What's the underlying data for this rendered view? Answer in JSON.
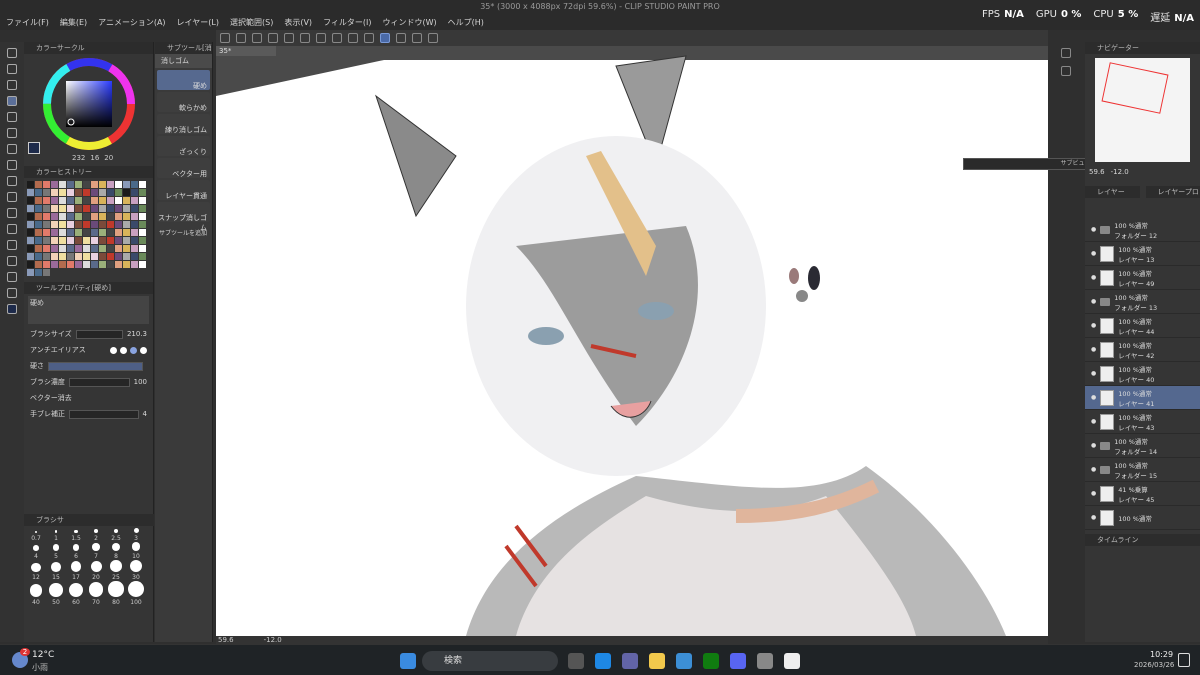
{
  "window": {
    "title": "35* (3000 x 4088px 72dpi 59.6%) - CLIP STUDIO PAINT PRO"
  },
  "menu": [
    "ファイル(F)",
    "編集(E)",
    "アニメーション(A)",
    "レイヤー(L)",
    "選択範囲(S)",
    "表示(V)",
    "フィルター(I)",
    "ウィンドウ(W)",
    "ヘルプ(H)"
  ],
  "stats": {
    "fps_label": "FPS",
    "fps": "N/A",
    "gpu_label": "GPU",
    "gpu": "0 %",
    "cpu_label": "CPU",
    "cpu": "5 %",
    "delay_label": "遅延",
    "delay": "N/A"
  },
  "panels": {
    "color_wheel": "カラーサークル",
    "color_history": "カラーヒストリー",
    "tool_property": "ツールプロパティ[硬め]",
    "subtool_header": "サブツール[消",
    "brush_size_panel": "ブラシサ",
    "navigator": "ナビゲーター",
    "layer_tab": "レイヤー",
    "layer_property": "レイヤープロ",
    "sub_view": "サブビュー",
    "timeline": "タイムライン"
  },
  "color_values": {
    "h": "232",
    "s": "16",
    "v": "20"
  },
  "subtool": {
    "group": "消しゴム",
    "items": [
      "硬め",
      "軟らかめ",
      "練り消しゴム",
      "ざっくり",
      "ベクター用",
      "レイヤー貫通",
      "スナップ消しゴム"
    ],
    "add_label": "サブツールを追加"
  },
  "tool_property": {
    "preset": "硬め",
    "brush_size_label": "ブラシサイズ",
    "brush_size": "210.3",
    "antialias_label": "アンチエイリアス",
    "hardness_label": "硬さ",
    "density_label": "ブラシ濃度",
    "density": "100",
    "vector_erase_label": "ベクター消去",
    "stabilizer_label": "手ブレ補正",
    "stabilizer": "4"
  },
  "brush_sizes": [
    "0.7",
    "1",
    "1.5",
    "2",
    "2.5",
    "3",
    "4",
    "5",
    "6",
    "7",
    "8",
    "10",
    "12",
    "15",
    "17",
    "20",
    "25",
    "30",
    "40",
    "50",
    "60",
    "70",
    "80",
    "100"
  ],
  "canvas": {
    "tab": "35*",
    "zoom": "59.6",
    "rotation": "-12.0"
  },
  "navigator": {
    "zoom": "59.6",
    "rotation": "-12.0"
  },
  "layers": [
    {
      "pct": "100 %通常",
      "name": "フォルダー 12",
      "type": "folder"
    },
    {
      "pct": "100 %通常",
      "name": "レイヤー 13",
      "type": "layer"
    },
    {
      "pct": "100 %通常",
      "name": "レイヤー 49",
      "type": "layer"
    },
    {
      "pct": "100 %通常",
      "name": "フォルダー 13",
      "type": "folder"
    },
    {
      "pct": "100 %通常",
      "name": "レイヤー 44",
      "type": "layer"
    },
    {
      "pct": "100 %通常",
      "name": "レイヤー 42",
      "type": "layer"
    },
    {
      "pct": "100 %通常",
      "name": "レイヤー 40",
      "type": "layer"
    },
    {
      "pct": "100 %通常",
      "name": "レイヤー 41",
      "type": "layer",
      "selected": true
    },
    {
      "pct": "100 %通常",
      "name": "レイヤー 43",
      "type": "layer"
    },
    {
      "pct": "100 %通常",
      "name": "フォルダー 14",
      "type": "folder"
    },
    {
      "pct": "100 %通常",
      "name": "フォルダー 15",
      "type": "folder"
    },
    {
      "pct": "41 %乗算",
      "name": "レイヤー 45",
      "type": "layer"
    },
    {
      "pct": "100 %通常",
      "name": "",
      "type": "layer"
    }
  ],
  "taskbar": {
    "weather_temp": "12°C",
    "weather_desc": "小雨",
    "search_placeholder": "検索",
    "time": "10:29",
    "date": "2026/03/26",
    "badge": "2"
  },
  "colors": {
    "accent": "#5b6f99",
    "app_bg": "#2f2f2f",
    "panel": "#353535",
    "taskbar": "#1f2326"
  }
}
